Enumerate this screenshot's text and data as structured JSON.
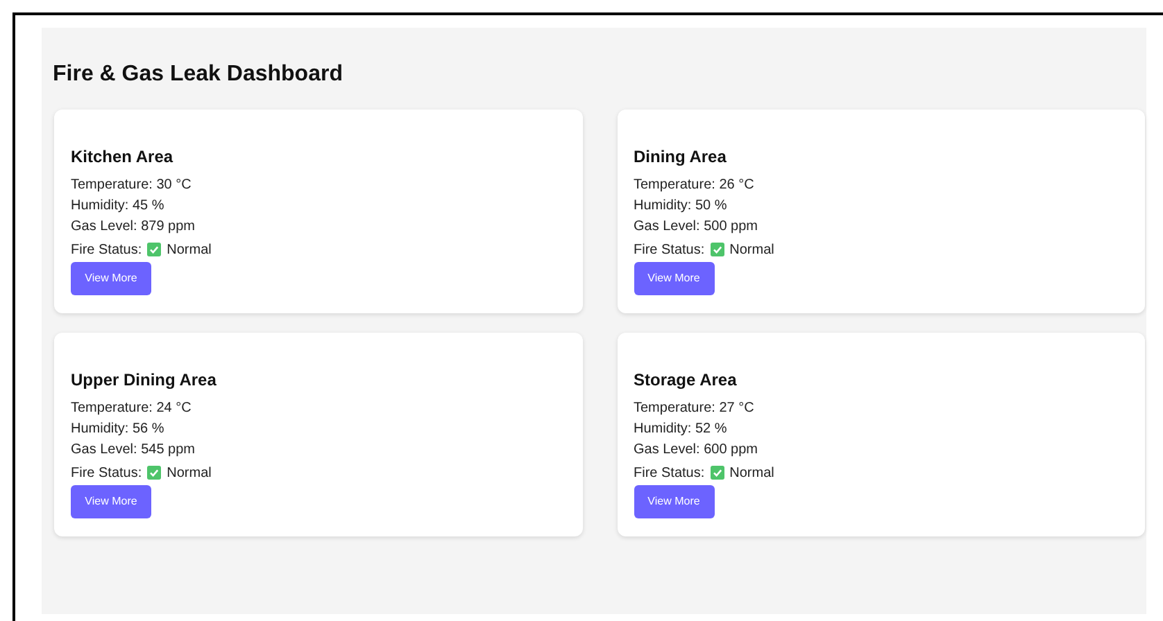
{
  "title": "Fire & Gas Leak Dashboard",
  "areas": [
    {
      "name": "Kitchen Area",
      "lines": [
        "Temperature: 30 °C",
        "Humidity: 45 %",
        "Gas Level: 879 ppm"
      ],
      "fire_label": "Fire Status:",
      "fire_status": "Normal",
      "button": "View More"
    },
    {
      "name": "Dining Area",
      "lines": [
        "Temperature: 26 °C",
        "Humidity: 50 %",
        "Gas Level: 500 ppm"
      ],
      "fire_label": "Fire Status:",
      "fire_status": "Normal",
      "button": "View More"
    },
    {
      "name": "Upper Dining Area",
      "lines": [
        "Temperature: 24 °C",
        "Humidity: 56 %",
        "Gas Level: 545 ppm"
      ],
      "fire_label": "Fire Status:",
      "fire_status": "Normal",
      "button": "View More"
    },
    {
      "name": "Storage Area",
      "lines": [
        "Temperature: 27 °C",
        "Humidity: 52 %",
        "Gas Level: 600 ppm"
      ],
      "fire_label": "Fire Status:",
      "fire_status": "Normal",
      "button": "View More"
    }
  ]
}
